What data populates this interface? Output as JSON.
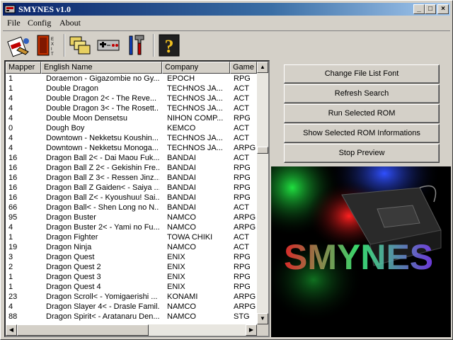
{
  "window": {
    "title": "SMYNES v1.0"
  },
  "menu": {
    "file": "File",
    "config": "Config",
    "about": "About"
  },
  "columns": {
    "mapper": "Mapper",
    "name": "English Name",
    "company": "Company",
    "genre": "Game"
  },
  "roms": [
    {
      "m": "1",
      "n": "Doraemon - Gigazombie no Gy...",
      "c": "EPOCH",
      "g": "RPG"
    },
    {
      "m": "1",
      "n": "Double Dragon",
      "c": "TECHNOS JA...",
      "g": "ACT"
    },
    {
      "m": "4",
      "n": "Double Dragon 2< - The Reve...",
      "c": "TECHNOS JA...",
      "g": "ACT"
    },
    {
      "m": "4",
      "n": "Double Dragon 3< - The Rosett...",
      "c": "TECHNOS JA...",
      "g": "ACT"
    },
    {
      "m": "4",
      "n": "Double Moon Densetsu",
      "c": "NIHON COMP...",
      "g": "RPG"
    },
    {
      "m": "0",
      "n": "Dough Boy",
      "c": "KEMCO",
      "g": "ACT"
    },
    {
      "m": "4",
      "n": "Downtown - Nekketsu Koushin...",
      "c": "TECHNOS JA...",
      "g": "ACT"
    },
    {
      "m": "4",
      "n": "Downtown - Nekketsu Monoga...",
      "c": "TECHNOS JA...",
      "g": "ARPG"
    },
    {
      "m": "16",
      "n": "Dragon Ball 2< - Dai Maou Fuk...",
      "c": "BANDAI",
      "g": "ACT"
    },
    {
      "m": "16",
      "n": "Dragon Ball Z 2< - Gekishin Fre...",
      "c": "BANDAI",
      "g": "RPG"
    },
    {
      "m": "16",
      "n": "Dragon Ball Z 3< - Ressen Jinz...",
      "c": "BANDAI",
      "g": "RPG"
    },
    {
      "m": "16",
      "n": "Dragon Ball Z Gaiden< - Saiya ...",
      "c": "BANDAI",
      "g": "RPG"
    },
    {
      "m": "16",
      "n": "Dragon Ball Z< - Kyoushuu! Sai...",
      "c": "BANDAI",
      "g": "RPG"
    },
    {
      "m": "66",
      "n": "Dragon Ball< - Shen Long no N...",
      "c": "BANDAI",
      "g": "ACT"
    },
    {
      "m": "95",
      "n": "Dragon Buster",
      "c": "NAMCO",
      "g": "ARPG"
    },
    {
      "m": "4",
      "n": "Dragon Buster 2< - Yami no Fu...",
      "c": "NAMCO",
      "g": "ARPG"
    },
    {
      "m": "1",
      "n": "Dragon Fighter",
      "c": "TOWA CHIKI",
      "g": "ACT"
    },
    {
      "m": "19",
      "n": "Dragon Ninja",
      "c": "NAMCO",
      "g": "ACT"
    },
    {
      "m": "3",
      "n": "Dragon Quest",
      "c": "ENIX",
      "g": "RPG"
    },
    {
      "m": "2",
      "n": "Dragon Quest 2",
      "c": "ENIX",
      "g": "RPG"
    },
    {
      "m": "1",
      "n": "Dragon Quest 3",
      "c": "ENIX",
      "g": "RPG"
    },
    {
      "m": "1",
      "n": "Dragon Quest 4",
      "c": "ENIX",
      "g": "RPG"
    },
    {
      "m": "23",
      "n": "Dragon Scroll< - Yomigaerishi ...",
      "c": "KONAMI",
      "g": "ARPG"
    },
    {
      "m": "4",
      "n": "Dragon Slayer 4< - Drasle Famil...",
      "c": "NAMCO",
      "g": "ARPG"
    },
    {
      "m": "88",
      "n": "Dragon Spirit< - Aratanaru Den...",
      "c": "NAMCO",
      "g": "STG"
    }
  ],
  "buttons": {
    "font": "Change File List Font",
    "refresh": "Refresh Search",
    "run": "Run Selected ROM",
    "info": "Show Selected ROM Informations",
    "stop": "Stop Preview"
  },
  "preview": {
    "logo_text": "SMYNES"
  },
  "toolbar_icons": [
    "load-rom-icon",
    "exit-icon",
    "browse-folders-icon",
    "controller-config-icon",
    "tools-config-icon",
    "help-icon"
  ]
}
